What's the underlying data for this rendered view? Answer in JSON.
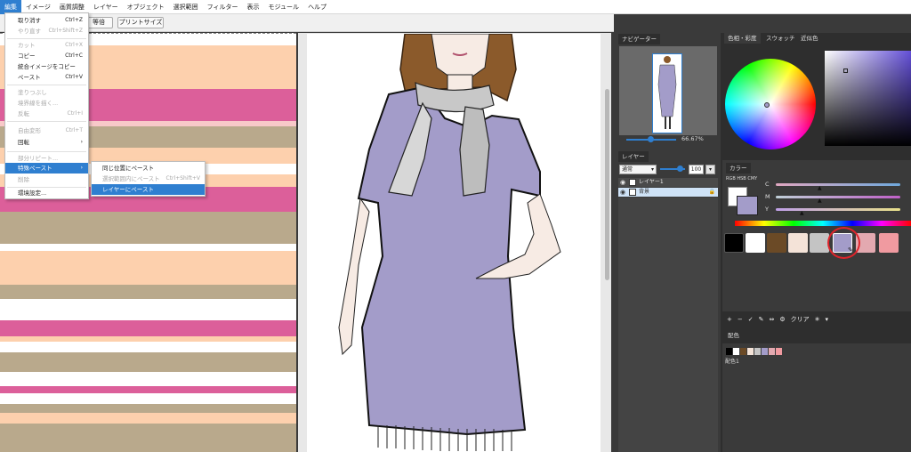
{
  "menubar": {
    "items": [
      "編集",
      "イメージ",
      "画質調整",
      "レイヤー",
      "オブジェクト",
      "選択範囲",
      "フィルター",
      "表示",
      "モジュール",
      "ヘルプ"
    ],
    "active_index": 0
  },
  "toolbar": {
    "actual_size_label": "等倍",
    "print_size_label": "プリントサイズ"
  },
  "edit_menu": {
    "items": [
      {
        "label": "取り消す",
        "shortcut": "Ctrl+Z",
        "disabled": false
      },
      {
        "label": "やり直す",
        "shortcut": "Ctrl+Shift+Z",
        "disabled": true
      },
      {
        "label": "カット",
        "shortcut": "Ctrl+X",
        "disabled": true
      },
      {
        "label": "コピー",
        "shortcut": "Ctrl+C",
        "disabled": false
      },
      {
        "label": "統合イメージをコピー",
        "shortcut": "",
        "disabled": false
      },
      {
        "label": "ペースト",
        "shortcut": "Ctrl+V",
        "disabled": false
      },
      {
        "label": "塗りつぶし",
        "shortcut": "",
        "disabled": true
      },
      {
        "label": "境界線を描く...",
        "shortcut": "",
        "disabled": true
      },
      {
        "label": "反転",
        "shortcut": "Ctrl+I",
        "disabled": true
      },
      {
        "label": "自由変形",
        "shortcut": "Ctrl+T",
        "disabled": true
      },
      {
        "label": "回転",
        "shortcut": "",
        "disabled": false
      },
      {
        "label": "部分リピート...",
        "shortcut": "",
        "disabled": true
      },
      {
        "label": "特殊ペースト",
        "shortcut": "",
        "disabled": false
      },
      {
        "label": "削除",
        "shortcut": "",
        "disabled": true
      },
      {
        "label": "環境設定...",
        "shortcut": "",
        "disabled": false
      }
    ]
  },
  "paste_submenu": {
    "items": [
      {
        "label": "同じ位置にペースト",
        "shortcut": "",
        "disabled": false
      },
      {
        "label": "選択範囲内にペースト",
        "shortcut": "Ctrl+Shift+V",
        "disabled": true
      },
      {
        "label": "レイヤーにペースト",
        "shortcut": "",
        "disabled": false
      }
    ],
    "active_index": 2
  },
  "navigator": {
    "tab_label": "ナビゲーター",
    "zoom": "66.67%"
  },
  "layers": {
    "tab_label": "レイヤー",
    "blend_mode": "通常",
    "opacity": "100",
    "items": [
      {
        "name": "レイヤー1",
        "selected": false
      },
      {
        "name": "背景",
        "selected": true
      }
    ]
  },
  "color_panel": {
    "tabs": [
      "色相・彩度",
      "スウォッチ",
      "近似色"
    ],
    "sub_tab": "カラー",
    "modes": "RGB HSB CMY",
    "sliders": [
      "C",
      "M",
      "Y"
    ],
    "current_color": "#a39cc9",
    "swatches": [
      "#000000",
      "#ffffff",
      "#6b4a26",
      "#f4e3d8",
      "#c4c4c4",
      "#a39cc9",
      "#e3a9b0",
      "#f09aa0"
    ],
    "toolbar_label": "クリア",
    "highlight_color": "#e0242b"
  },
  "palette": {
    "tab_label": "配色",
    "set_label": "配色1",
    "colors": [
      "#000000",
      "#ffffff",
      "#6b4a26",
      "#f4e3d8",
      "#c4c4c4",
      "#a39cc9",
      "#e3a9b0",
      "#f09aa0"
    ]
  }
}
